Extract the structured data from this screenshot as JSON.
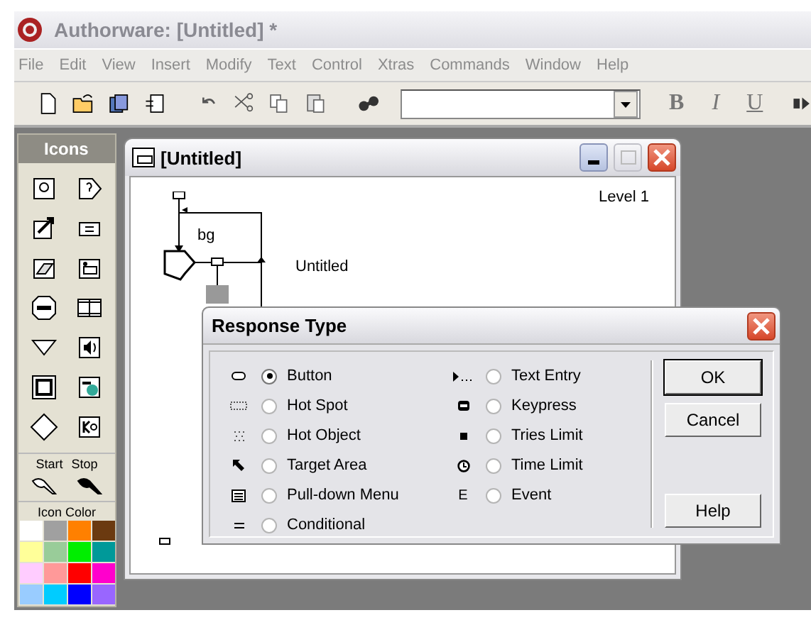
{
  "app": {
    "title": "Authorware: [Untitled] *"
  },
  "menu": [
    "File",
    "Edit",
    "View",
    "Insert",
    "Modify",
    "Text",
    "Control",
    "Xtras",
    "Commands",
    "Window",
    "Help"
  ],
  "toolbar": {
    "format_buttons": [
      "B",
      "I",
      "U"
    ]
  },
  "palette": {
    "title": "Icons",
    "start_label": "Start",
    "stop_label": "Stop",
    "color_title": "Icon Color",
    "colors": [
      {
        "color": "#ffffff"
      },
      {
        "color": "#a0a0a0"
      },
      {
        "color": "#ff8000"
      },
      {
        "color": "#6b3a10"
      },
      {
        "color": "#ffff99"
      },
      {
        "color": "#99cc99"
      },
      {
        "color": "#00ee00"
      },
      {
        "color": "#009999"
      },
      {
        "color": "#ffccff"
      },
      {
        "color": "#ff9999"
      },
      {
        "color": "#ff0000"
      },
      {
        "color": "#ff00cc"
      },
      {
        "color": "#99ccff"
      },
      {
        "color": "#00ccff"
      },
      {
        "color": "#0000ff"
      },
      {
        "color": "#9966ff"
      }
    ]
  },
  "document": {
    "title": "[Untitled]",
    "level": "Level 1",
    "response_label": "bg",
    "target_label": "Untitled"
  },
  "dialog": {
    "title": "Response Type",
    "columns": [
      [
        {
          "kind": "button",
          "label": "Button",
          "selected": true
        },
        {
          "kind": "hotspot",
          "label": "Hot Spot",
          "selected": false
        },
        {
          "kind": "hotobject",
          "label": "Hot Object",
          "selected": false
        },
        {
          "kind": "target",
          "label": "Target Area",
          "selected": false
        },
        {
          "kind": "pulldown",
          "label": "Pull-down Menu",
          "selected": false
        },
        {
          "kind": "conditional",
          "label": "Conditional",
          "selected": false
        }
      ],
      [
        {
          "kind": "textentry",
          "label": "Text Entry",
          "selected": false
        },
        {
          "kind": "keypress",
          "label": "Keypress",
          "selected": false
        },
        {
          "kind": "tries",
          "label": "Tries Limit",
          "selected": false
        },
        {
          "kind": "time",
          "label": "Time Limit",
          "selected": false
        },
        {
          "kind": "event",
          "label": "Event",
          "symbol": "E",
          "selected": false
        }
      ]
    ],
    "buttons": [
      {
        "label": "OK",
        "default": true
      },
      {
        "label": "Cancel",
        "default": false
      },
      {
        "label": "Help",
        "default": false
      }
    ]
  }
}
